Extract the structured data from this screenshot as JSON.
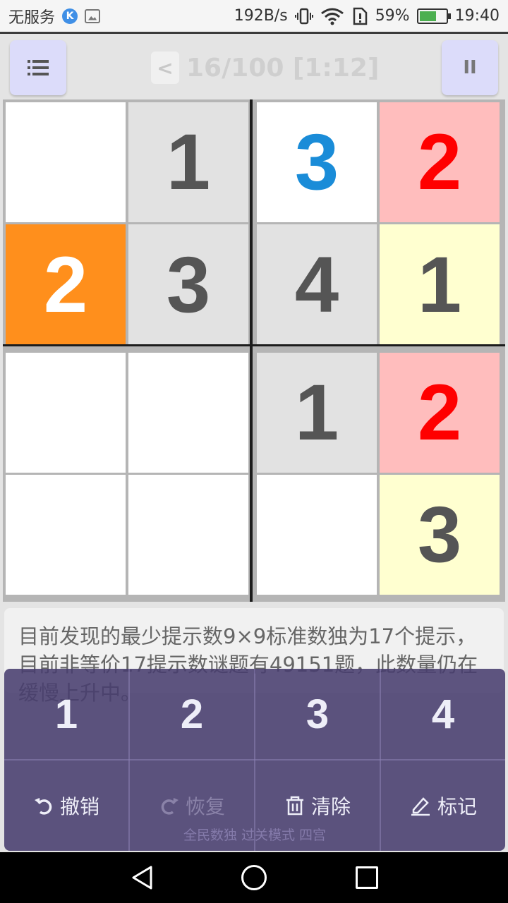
{
  "status_bar": {
    "carrier": "无服务",
    "speed": "192B/s",
    "battery_percent": "59%",
    "time": "19:40",
    "icons": [
      "k-app-icon",
      "gallery-icon",
      "vibrate-icon",
      "wifi-icon",
      "sim-alert-icon",
      "battery-charging-icon"
    ]
  },
  "header": {
    "menu_icon": "list-icon",
    "prev_label": "<",
    "level_text": "16/100 [1:12]",
    "pause_label": "II"
  },
  "board": {
    "size": 4,
    "cells": [
      [
        {
          "v": "",
          "bg": "#ffffff",
          "fg": "#555555"
        },
        {
          "v": "1",
          "bg": "#e2e2e2",
          "fg": "#555555"
        },
        {
          "v": "3",
          "bg": "#ffffff",
          "fg": "#1a8cd8"
        },
        {
          "v": "2",
          "bg": "#ffbdbd",
          "fg": "#ff0000"
        }
      ],
      [
        {
          "v": "2",
          "bg": "#ff8f1c",
          "fg": "#ffffff"
        },
        {
          "v": "3",
          "bg": "#e2e2e2",
          "fg": "#555555"
        },
        {
          "v": "4",
          "bg": "#e2e2e2",
          "fg": "#555555"
        },
        {
          "v": "1",
          "bg": "#ffffd0",
          "fg": "#555555"
        }
      ],
      [
        {
          "v": "",
          "bg": "#ffffff",
          "fg": "#555555"
        },
        {
          "v": "",
          "bg": "#ffffff",
          "fg": "#555555"
        },
        {
          "v": "1",
          "bg": "#e2e2e2",
          "fg": "#555555"
        },
        {
          "v": "2",
          "bg": "#ffbdbd",
          "fg": "#ff0000"
        }
      ],
      [
        {
          "v": "",
          "bg": "#ffffff",
          "fg": "#555555"
        },
        {
          "v": "",
          "bg": "#ffffff",
          "fg": "#555555"
        },
        {
          "v": "",
          "bg": "#ffffff",
          "fg": "#555555"
        },
        {
          "v": "3",
          "bg": "#ffffd0",
          "fg": "#555555"
        }
      ]
    ]
  },
  "tip": {
    "text": "目前发现的最少提示数9×9标准数独为17个提示，目前非等价17提示数谜题有49151题，此数量仍在缓慢上升中。"
  },
  "pad": {
    "numbers": [
      "1",
      "2",
      "3",
      "4"
    ],
    "undo_label": "撤销",
    "redo_label": "恢复",
    "clear_label": "清除",
    "mark_label": "标记",
    "footer": "全民数独 过关模式 四宫"
  },
  "colors": {
    "pad_bg": "#483e6e",
    "board_line": "#1c1c1c",
    "header_button": "#dcdcfa"
  }
}
